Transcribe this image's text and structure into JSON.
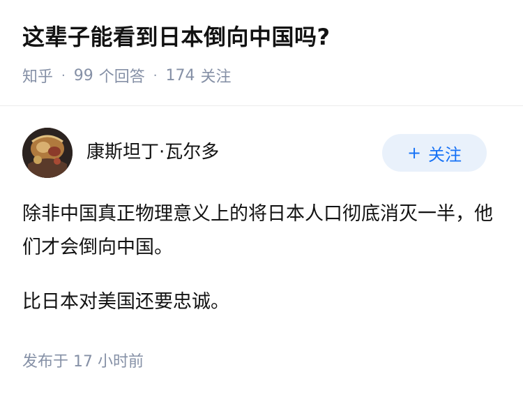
{
  "question": {
    "title": "这辈子能看到日本倒向中国吗?",
    "source": "知乎",
    "answers_count": "99",
    "answers_label": "个回答",
    "followers_count": "174",
    "followers_label": "关注"
  },
  "answer": {
    "author_name": "康斯坦丁·瓦尔多",
    "follow_plus": "+",
    "follow_label": "关注",
    "paragraphs": [
      "除非中国真正物理意义上的将日本人口彻底消灭一半，他们才会倒向中国。",
      "比日本对美国还要忠诚。"
    ],
    "publish_label": "发布于",
    "publish_time": "17 小时前"
  }
}
